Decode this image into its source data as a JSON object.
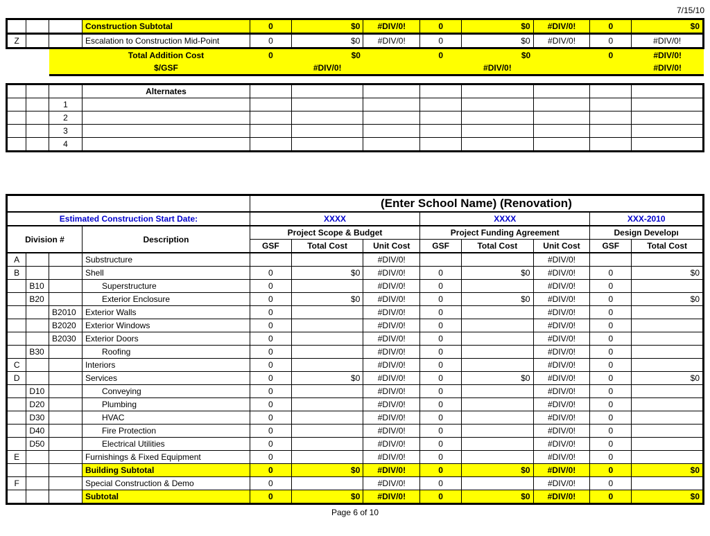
{
  "date_top": "7/15/10",
  "top": {
    "row_construction_subtotal": {
      "label": "Construction Subtotal",
      "g1": "0",
      "tc1": "$0",
      "uc1": "#DIV/0!",
      "g2": "0",
      "tc2": "$0",
      "uc2": "#DIV/0!",
      "g3": "0",
      "tc3": "$0"
    },
    "row_escalation": {
      "code": "Z",
      "label": "Escalation to Construction Mid-Point",
      "g1": "0",
      "tc1": "$0",
      "uc1": "#DIV/0!",
      "g2": "0",
      "tc2": "$0",
      "uc2": "#DIV/0!",
      "g3": "0",
      "tc3": "#DIV/0!"
    },
    "row_total_addition": {
      "label": "Total Addition Cost",
      "g1": "0",
      "tc1": "$0",
      "g2": "0",
      "tc2": "$0",
      "g3": "0",
      "tc3": "#DIV/0!"
    },
    "row_pergsf": {
      "label": "$/GSF",
      "uc1": "#DIV/0!",
      "uc2": "#DIV/0!",
      "uc3": "#DIV/0!"
    }
  },
  "alternates": {
    "title": "Alternates",
    "rows": [
      "1",
      "2",
      "3",
      "4"
    ]
  },
  "schoolTitle": "(Enter School Name) (Renovation)",
  "startDateLabel": "Estimated Construction Start Date:",
  "phase1": "XXXX",
  "phase2": "XXXX",
  "phase3": "XXX-2010",
  "hdr": {
    "division": "Division #",
    "description": "Description",
    "scope": "Project Scope & Budget",
    "funding": "Project Funding Agreement",
    "design": "Design Developı",
    "gsf": "GSF",
    "totalCost": "Total Cost",
    "unitCost": "Unit Cost"
  },
  "rows": [
    {
      "c1": "A",
      "c2": "",
      "c3": "",
      "desc": "Substructure",
      "indent": 0,
      "g1": "",
      "tc1": "",
      "uc1": "#DIV/0!",
      "g2": "",
      "tc2": "",
      "uc2": "#DIV/0!",
      "g3": "",
      "tc3": ""
    },
    {
      "c1": "B",
      "c2": "",
      "c3": "",
      "desc": "Shell",
      "indent": 0,
      "g1": "0",
      "tc1": "$0",
      "uc1": "#DIV/0!",
      "g2": "0",
      "tc2": "$0",
      "uc2": "#DIV/0!",
      "g3": "0",
      "tc3": "$0"
    },
    {
      "c1": "",
      "c2": "B10",
      "c3": "",
      "desc": "Superstructure",
      "indent": 1,
      "g1": "0",
      "tc1": "",
      "uc1": "#DIV/0!",
      "g2": "0",
      "tc2": "",
      "uc2": "#DIV/0!",
      "g3": "0",
      "tc3": ""
    },
    {
      "c1": "",
      "c2": "B20",
      "c3": "",
      "desc": "Exterior Enclosure",
      "indent": 1,
      "g1": "0",
      "tc1": "$0",
      "uc1": "#DIV/0!",
      "g2": "0",
      "tc2": "$0",
      "uc2": "#DIV/0!",
      "g3": "0",
      "tc3": "$0"
    },
    {
      "c1": "",
      "c2": "",
      "c3": "B2010",
      "desc": "Exterior Walls",
      "indent": 0,
      "g1": "0",
      "tc1": "",
      "uc1": "#DIV/0!",
      "g2": "0",
      "tc2": "",
      "uc2": "#DIV/0!",
      "g3": "0",
      "tc3": ""
    },
    {
      "c1": "",
      "c2": "",
      "c3": "B2020",
      "desc": "Exterior Windows",
      "indent": 0,
      "g1": "0",
      "tc1": "",
      "uc1": "#DIV/0!",
      "g2": "0",
      "tc2": "",
      "uc2": "#DIV/0!",
      "g3": "0",
      "tc3": ""
    },
    {
      "c1": "",
      "c2": "",
      "c3": "B2030",
      "desc": "Exterior Doors",
      "indent": 0,
      "g1": "0",
      "tc1": "",
      "uc1": "#DIV/0!",
      "g2": "0",
      "tc2": "",
      "uc2": "#DIV/0!",
      "g3": "0",
      "tc3": ""
    },
    {
      "c1": "",
      "c2": "B30",
      "c3": "",
      "desc": "Roofing",
      "indent": 1,
      "g1": "0",
      "tc1": "",
      "uc1": "#DIV/0!",
      "g2": "0",
      "tc2": "",
      "uc2": "#DIV/0!",
      "g3": "0",
      "tc3": ""
    },
    {
      "c1": "C",
      "c2": "",
      "c3": "",
      "desc": "Interiors",
      "indent": 0,
      "g1": "0",
      "tc1": "",
      "uc1": "#DIV/0!",
      "g2": "0",
      "tc2": "",
      "uc2": "#DIV/0!",
      "g3": "0",
      "tc3": ""
    },
    {
      "c1": "D",
      "c2": "",
      "c3": "",
      "desc": "Services",
      "indent": 0,
      "g1": "0",
      "tc1": "$0",
      "uc1": "#DIV/0!",
      "g2": "0",
      "tc2": "$0",
      "uc2": "#DIV/0!",
      "g3": "0",
      "tc3": "$0"
    },
    {
      "c1": "",
      "c2": "D10",
      "c3": "",
      "desc": "Conveying",
      "indent": 1,
      "g1": "0",
      "tc1": "",
      "uc1": "#DIV/0!",
      "g2": "0",
      "tc2": "",
      "uc2": "#DIV/0!",
      "g3": "0",
      "tc3": ""
    },
    {
      "c1": "",
      "c2": "D20",
      "c3": "",
      "desc": "Plumbing",
      "indent": 1,
      "g1": "0",
      "tc1": "",
      "uc1": "#DIV/0!",
      "g2": "0",
      "tc2": "",
      "uc2": "#DIV/0!",
      "g3": "0",
      "tc3": ""
    },
    {
      "c1": "",
      "c2": "D30",
      "c3": "",
      "desc": "HVAC",
      "indent": 1,
      "g1": "0",
      "tc1": "",
      "uc1": "#DIV/0!",
      "g2": "0",
      "tc2": "",
      "uc2": "#DIV/0!",
      "g3": "0",
      "tc3": ""
    },
    {
      "c1": "",
      "c2": "D40",
      "c3": "",
      "desc": "Fire Protection",
      "indent": 1,
      "g1": "0",
      "tc1": "",
      "uc1": "#DIV/0!",
      "g2": "0",
      "tc2": "",
      "uc2": "#DIV/0!",
      "g3": "0",
      "tc3": ""
    },
    {
      "c1": "",
      "c2": "D50",
      "c3": "",
      "desc": "Electrical Utilities",
      "indent": 1,
      "g1": "0",
      "tc1": "",
      "uc1": "#DIV/0!",
      "g2": "0",
      "tc2": "",
      "uc2": "#DIV/0!",
      "g3": "0",
      "tc3": ""
    },
    {
      "c1": "E",
      "c2": "",
      "c3": "",
      "desc": "Furnishings & Fixed Equipment",
      "indent": 0,
      "g1": "0",
      "tc1": "",
      "uc1": "#DIV/0!",
      "g2": "0",
      "tc2": "",
      "uc2": "#DIV/0!",
      "g3": "0",
      "tc3": ""
    }
  ],
  "buildingSubtotal": {
    "label": "Building Subtotal",
    "g1": "0",
    "tc1": "$0",
    "uc1": "#DIV/0!",
    "g2": "0",
    "tc2": "$0",
    "uc2": "#DIV/0!",
    "g3": "0",
    "tc3": "$0"
  },
  "specialConstruction": {
    "c1": "F",
    "label": "Special Construction & Demo",
    "g1": "0",
    "tc1": "",
    "uc1": "#DIV/0!",
    "g2": "0",
    "tc2": "",
    "uc2": "#DIV/0!",
    "g3": "0",
    "tc3": ""
  },
  "subtotal": {
    "label": "Subtotal",
    "g1": "0",
    "tc1": "$0",
    "uc1": "#DIV/0!",
    "g2": "0",
    "tc2": "$0",
    "uc2": "#DIV/0!",
    "g3": "0",
    "tc3": "$0"
  },
  "pageNumber": "Page 6 of 10"
}
